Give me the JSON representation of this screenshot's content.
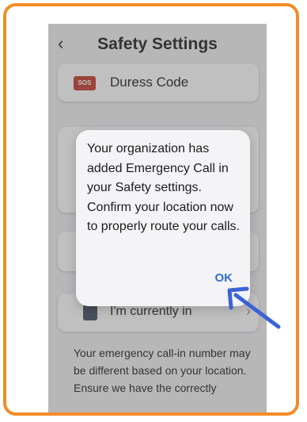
{
  "header": {
    "back_glyph": "‹",
    "title": "Safety Settings"
  },
  "cards": {
    "duress": {
      "badge": "SOS",
      "label": "Duress Code"
    },
    "location": {
      "label": "I'm currently in",
      "chevron": "›"
    }
  },
  "footer_text": "Your emergency call-in number may be different based on your location. Ensure we have the correctly",
  "dialog": {
    "message": "Your organization has added Emergency Call in your Safety settings. Confirm your location now to properly route your calls.",
    "ok_label": "OK"
  },
  "colors": {
    "frame_border": "#f28c28",
    "accent": "#2f6fd0",
    "arrow": "#3b63d6",
    "sos": "#c0392b"
  },
  "icons": [
    "back-chevron-icon",
    "sos-icon",
    "location-icon",
    "chevron-right-icon",
    "pointer-arrow-icon"
  ]
}
